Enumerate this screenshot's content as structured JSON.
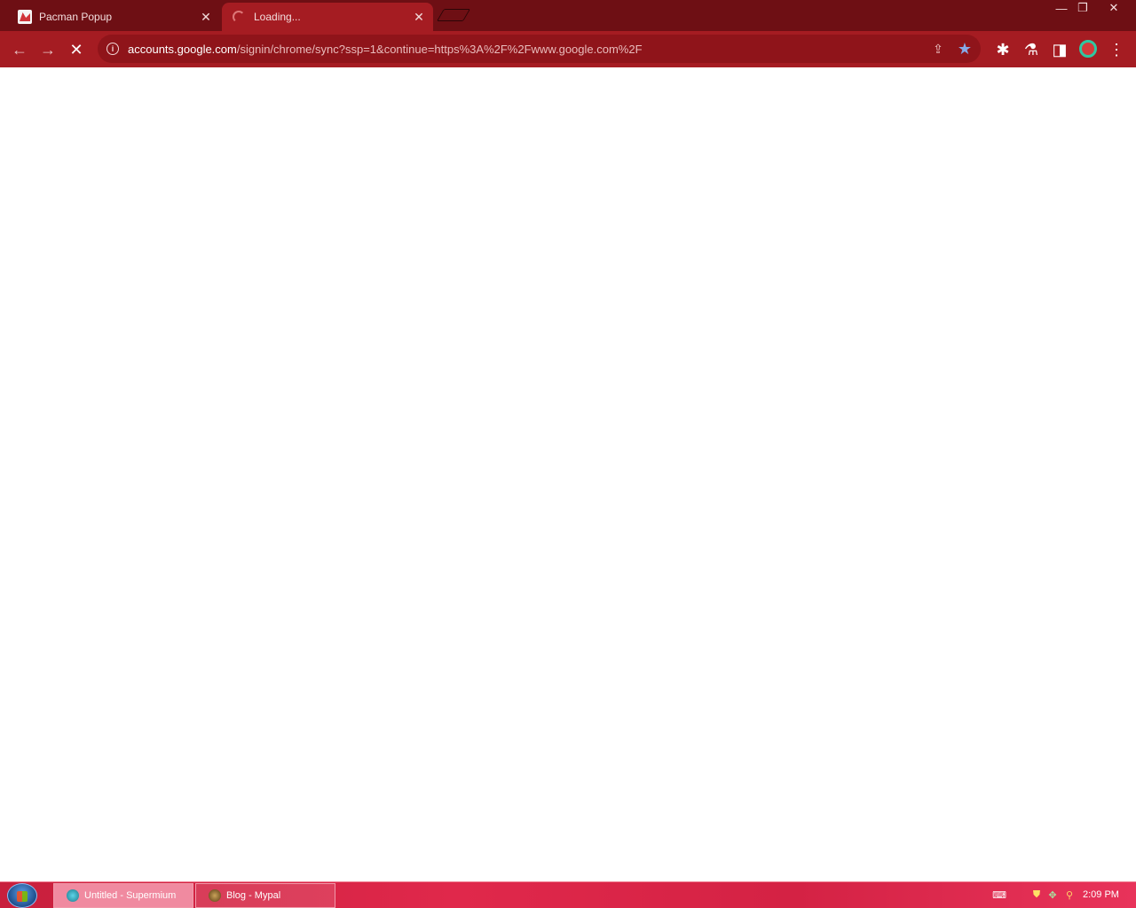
{
  "tabs": [
    {
      "title": "Pacman Popup",
      "close_glyph": "✕",
      "icon": "pacman-favicon"
    },
    {
      "title": "Loading...",
      "close_glyph": "✕",
      "icon": "loading-spinner"
    }
  ],
  "window_controls": {
    "minimize": "—",
    "restore": "❐",
    "close": "✕"
  },
  "toolbar": {
    "back_glyph": "←",
    "forward_glyph": "→",
    "stop_glyph": "✕",
    "info_glyph": "i",
    "url_host": "accounts.google.com",
    "url_rest": "/signin/chrome/sync?ssp=1&continue=https%3A%2F%2Fwww.google.com%2F",
    "share_glyph": "⇪",
    "star_glyph": "★",
    "extensions_glyph": "✱",
    "labs_glyph": "⚗",
    "sidepanel_glyph": "◨",
    "menu_glyph": "⋮"
  },
  "taskbar": {
    "tasks": [
      {
        "label": "Untitled - Supermium"
      },
      {
        "label": "Blog - Mypal"
      }
    ],
    "clock": "2:09 PM",
    "tray": {
      "keyboard": "⌨",
      "shield": "⛊",
      "network": "✥",
      "search": "⚲"
    }
  }
}
